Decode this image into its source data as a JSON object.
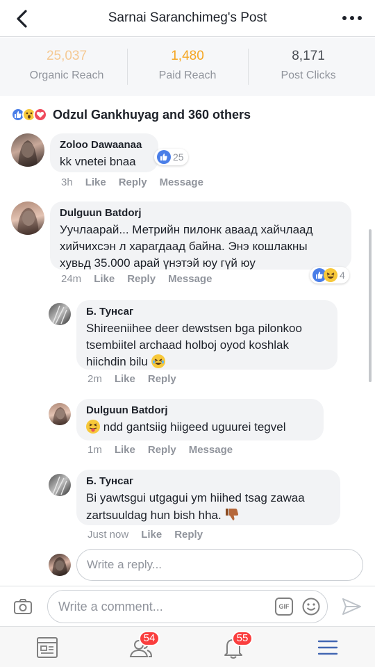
{
  "header": {
    "title": "Sarnai Saranchimeg's Post"
  },
  "stats": [
    {
      "value": "25,037",
      "label": "Organic Reach",
      "color": "#f5c993"
    },
    {
      "value": "1,480",
      "label": "Paid Reach",
      "color": "#f5a623"
    },
    {
      "value": "8,171",
      "label": "Post Clicks",
      "color": "#4b4f56"
    }
  ],
  "reactions": {
    "text": "Odzul Gankhuyag and 360 others",
    "icons": [
      "like-icon",
      "wow-icon",
      "love-icon"
    ]
  },
  "comments": [
    {
      "name": "Zoloo Dawaanaa",
      "text": "kk vnetei bnaa",
      "time": "3h",
      "actions": [
        "Like",
        "Reply",
        "Message"
      ],
      "reaction_count": "25"
    },
    {
      "name": "Dulguun Batdorj",
      "text": "Уучлаарай... Метрийн пилонк аваад хайчлаад хийчихсэн л харагдаад байна. Энэ кошлакны хувьд 35.000 арай үнэтэй юу гүй юу",
      "time": "24m",
      "actions": [
        "Like",
        "Reply",
        "Message"
      ],
      "reaction_count": "4"
    }
  ],
  "replies": [
    {
      "name": "Б. Тунсаг",
      "text": "Shireeniihee deer dewstsen bga pilonkoo tsembiitel archaad holboj oyod koshlak hiichdin bilu",
      "time": "2m",
      "actions": [
        "Like",
        "Reply"
      ]
    },
    {
      "name": "Dulguun Batdorj",
      "text": "ndd gantsiig hiigeed uguurei tegvel",
      "time": "1m",
      "actions": [
        "Like",
        "Reply",
        "Message"
      ]
    },
    {
      "name": "Б. Тунсаг",
      "text": "Bi yawtsgui utgagui ym hiihed tsag zawaa zartsuuldag hun bish hha.",
      "time": "Just now",
      "actions": [
        "Like",
        "Reply"
      ]
    }
  ],
  "reply_box": {
    "placeholder": "Write a reply..."
  },
  "composer": {
    "placeholder": "Write a comment...",
    "gif_label": "GIF"
  },
  "tabbar": {
    "friends_badge": "54",
    "notifications_badge": "55",
    "active_color": "#4267b2"
  }
}
